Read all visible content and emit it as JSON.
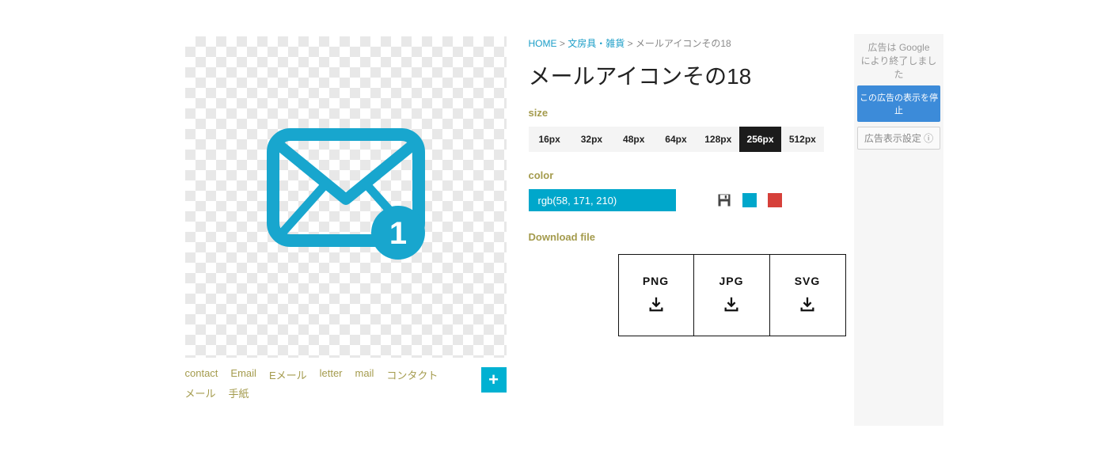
{
  "breadcrumb": {
    "home": "HOME",
    "sep": ">",
    "category": "文房具・雑貨",
    "current": "メールアイコンその18"
  },
  "title": "メールアイコンその18",
  "labels": {
    "size": "size",
    "color": "color",
    "download": "Download file"
  },
  "sizes": [
    "16px",
    "32px",
    "48px",
    "64px",
    "128px",
    "256px",
    "512px"
  ],
  "active_size_index": 5,
  "color_value": "rgb(58, 171, 210)",
  "downloads": [
    "PNG",
    "JPG",
    "SVG"
  ],
  "tags": [
    "contact",
    "Email",
    "Eメール",
    "letter",
    "mail",
    "コンタクト",
    "メール",
    "手紙"
  ],
  "add_button": "+",
  "ad": {
    "line1_prefix": "広告は ",
    "google": "Google",
    "line2": "により終了しました",
    "stop": "この広告の表示を停止",
    "settings": "広告表示設定 ⓘ"
  },
  "icon_color": "#18a6ce"
}
